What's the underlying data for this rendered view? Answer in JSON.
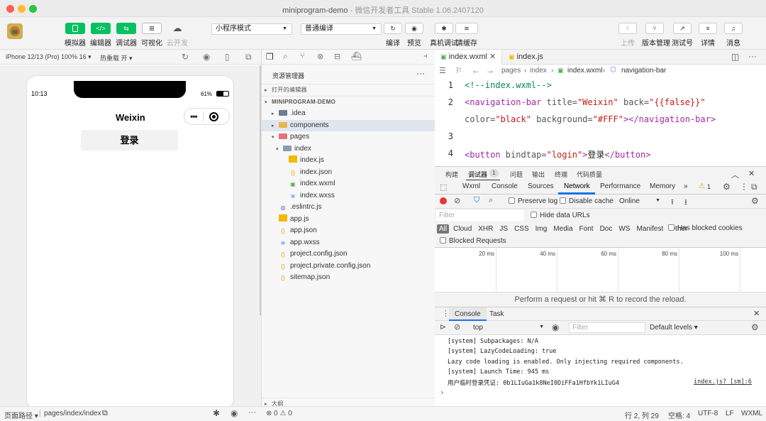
{
  "window": {
    "title": "miniprogram-demo",
    "subtitle": " - 微信开发者工具 Stable 1.06.2407120"
  },
  "toolbar": {
    "left_buttons": [
      {
        "label": "模拟器",
        "icon": "phone-icon"
      },
      {
        "label": "编辑器",
        "icon": "code-icon",
        "glyph": "</>"
      },
      {
        "label": "调试器",
        "icon": "debug-icon",
        "glyph": "⇆"
      },
      {
        "label": "可视化",
        "icon": "layout-icon",
        "glyph": "⊞"
      },
      {
        "label": "云开发",
        "icon": "cloud-icon",
        "glyph": "☁"
      }
    ],
    "mode_select": "小程序模式",
    "compile_select": "普通编译",
    "mid_buttons": [
      {
        "label": "编译",
        "glyph": "↻"
      },
      {
        "label": "预览",
        "glyph": "◉"
      },
      {
        "label": "真机调试",
        "glyph": "✱"
      },
      {
        "label": "清缓存",
        "glyph": "≋"
      }
    ],
    "right_buttons": [
      {
        "label": "上传",
        "glyph": "⇧"
      },
      {
        "label": "版本管理",
        "glyph": "⑂"
      },
      {
        "label": "测试号",
        "glyph": "↗"
      },
      {
        "label": "详情",
        "glyph": "≡"
      },
      {
        "label": "消息",
        "glyph": "♫"
      }
    ]
  },
  "simulator": {
    "device": "iPhone 12/13 (Pro) 100% 16 ▾",
    "hot_reload": "热重载 开 ▾",
    "time": "10:13",
    "battery": "61%",
    "nav_title": "Weixin",
    "login_button": "登录",
    "footer_path_label": "页面路径 ▾",
    "footer_path": "pages/index/index"
  },
  "explorer": {
    "title": "资源管理器",
    "open_editors": "打开的编辑器",
    "project": "MINIPROGRAM-DEMO",
    "items": [
      {
        "name": ".idea",
        "type": "folder",
        "depth": 1,
        "twisty": "▸",
        "color": "#6b7c93"
      },
      {
        "name": "components",
        "type": "folder",
        "depth": 1,
        "twisty": "▸",
        "color": "#e8b64a",
        "selected": true
      },
      {
        "name": "pages",
        "type": "folder",
        "depth": 1,
        "twisty": "▾",
        "color": "#e57373"
      },
      {
        "name": "index",
        "type": "folder",
        "depth": 2,
        "twisty": "▾",
        "color": "#8a9bb0"
      },
      {
        "name": "index.js",
        "type": "js",
        "depth": 3,
        "color": "#f5b800"
      },
      {
        "name": "index.json",
        "type": "json",
        "depth": 3,
        "color": "#e0a800"
      },
      {
        "name": "index.wxml",
        "type": "wxml",
        "depth": 3,
        "color": "#4caf50"
      },
      {
        "name": "index.wxss",
        "type": "wxss",
        "depth": 3,
        "color": "#2d7ff9"
      },
      {
        "name": ".eslintrc.js",
        "type": "eslint",
        "depth": 1,
        "color": "#4b32c3"
      },
      {
        "name": "app.js",
        "type": "js",
        "depth": 1,
        "color": "#f5b800"
      },
      {
        "name": "app.json",
        "type": "json",
        "depth": 1,
        "color": "#e0a800"
      },
      {
        "name": "app.wxss",
        "type": "wxss",
        "depth": 1,
        "color": "#2d7ff9"
      },
      {
        "name": "project.config.json",
        "type": "json",
        "depth": 1,
        "color": "#e0a800"
      },
      {
        "name": "project.private.config.json",
        "type": "json",
        "depth": 1,
        "color": "#e0a800"
      },
      {
        "name": "sitemap.json",
        "type": "json",
        "depth": 1,
        "color": "#e0a800"
      }
    ],
    "outline": "大纲",
    "problems": "⊗ 0 ⚠ 0"
  },
  "editor": {
    "tabs": [
      {
        "label": "index.wxml",
        "active": true
      },
      {
        "label": "index.js",
        "active": false
      }
    ],
    "breadcrumb": [
      "pages",
      "index",
      "index.wxml",
      "navigation-bar"
    ],
    "lines": [
      {
        "num": "1",
        "parts": [
          {
            "t": "<!--index.wxml-->",
            "c": "c-com"
          }
        ]
      },
      {
        "num": "2",
        "parts": [
          {
            "t": "<navigation-bar ",
            "c": "c-tag"
          },
          {
            "t": "title=",
            "c": "c-att"
          },
          {
            "t": "\"Weixin\"",
            "c": "c-str"
          },
          {
            "t": " back=",
            "c": "c-att"
          },
          {
            "t": "\"{{false}}\"",
            "c": "c-str"
          }
        ]
      },
      {
        "num": "",
        "parts": [
          {
            "t": "color=",
            "c": "c-att"
          },
          {
            "t": "\"black\"",
            "c": "c-str"
          },
          {
            "t": " background=",
            "c": "c-att"
          },
          {
            "t": "\"#FFF\"",
            "c": "c-str"
          },
          {
            "t": "></navigation-bar>",
            "c": "c-tag"
          }
        ]
      },
      {
        "num": "3",
        "parts": []
      },
      {
        "num": "4",
        "parts": [
          {
            "t": "<button ",
            "c": "c-tag"
          },
          {
            "t": "bindtap=",
            "c": "c-att"
          },
          {
            "t": "\"login\"",
            "c": "c-str"
          },
          {
            "t": ">",
            "c": "c-tag"
          },
          {
            "t": "登录",
            "c": "c-txt"
          },
          {
            "t": "</button>",
            "c": "c-tag"
          }
        ]
      }
    ]
  },
  "devtools": {
    "top_tabs": [
      "构建",
      "调试器",
      "问题",
      "输出",
      "终端",
      "代码质量"
    ],
    "debugger_badge": "1",
    "panel_tabs": [
      "Wxml",
      "Console",
      "Sources",
      "Network",
      "Performance",
      "Memory"
    ],
    "more": "»",
    "warn_count": "1",
    "network": {
      "preserve_log": "Preserve log",
      "disable_cache": "Disable cache",
      "throttle": "Online",
      "filter_placeholder": "Filter",
      "hide_data_urls": "Hide data URLs",
      "types": [
        "All",
        "Cloud",
        "XHR",
        "JS",
        "CSS",
        "Img",
        "Media",
        "Font",
        "Doc",
        "WS",
        "Manifest",
        "Other"
      ],
      "has_blocked_cookies": "Has blocked cookies",
      "blocked_requests": "Blocked Requests",
      "ticks": [
        "20 ms",
        "40 ms",
        "60 ms",
        "80 ms",
        "100 ms"
      ],
      "message": "Perform a request or hit ⌘ R to record the reload."
    },
    "console": {
      "tabs": [
        "Console",
        "Task"
      ],
      "context": "top",
      "filter_placeholder": "Filter",
      "levels": "Default levels ▾",
      "logs": [
        "[system] Subpackages: N/A",
        "[system] LazyCodeLoading: true",
        "Lazy code loading is enabled. Only injecting required components.",
        "[system] Launch Time: 945 ms",
        "用户临时登录凭证: 0b1LIuGa1k8NeI0DiFFa1HfbYk1LIuG4"
      ],
      "log_source": "index.js? [sm]:6",
      "prompt": "›"
    }
  },
  "status": {
    "position": "行 2, 列 29",
    "spaces": "空格: 4",
    "encoding": "UTF-8",
    "eol": "LF",
    "lang": "WXML"
  }
}
